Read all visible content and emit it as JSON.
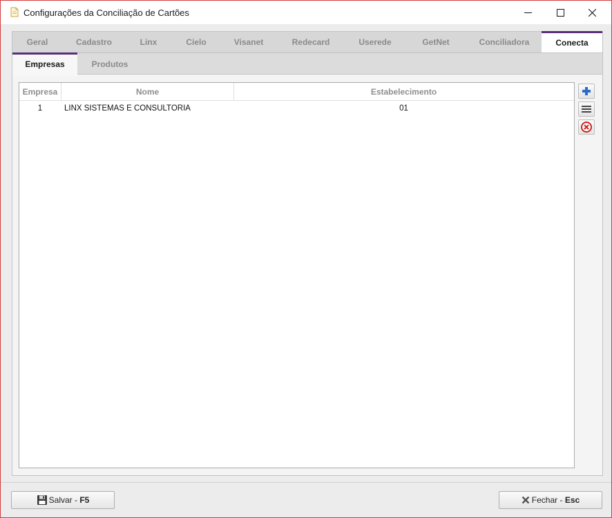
{
  "window": {
    "title": "Configurações da Conciliação de Cartões",
    "icon": "document-icon"
  },
  "main_tabs": [
    {
      "label": "Geral",
      "active": false
    },
    {
      "label": "Cadastro",
      "active": false
    },
    {
      "label": "Linx",
      "active": false
    },
    {
      "label": "Cielo",
      "active": false
    },
    {
      "label": "Visanet",
      "active": false
    },
    {
      "label": "Redecard",
      "active": false
    },
    {
      "label": "Userede",
      "active": false
    },
    {
      "label": "GetNet",
      "active": false
    },
    {
      "label": "Conciliadora",
      "active": false
    },
    {
      "label": "Conecta",
      "active": true
    }
  ],
  "sub_tabs": [
    {
      "label": "Empresas",
      "active": true
    },
    {
      "label": "Produtos",
      "active": false
    }
  ],
  "grid": {
    "columns": [
      "Empresa",
      "Nome",
      "Estabelecimento"
    ],
    "rows": [
      {
        "empresa": "1",
        "nome": "LINX SISTEMAS E CONSULTORIA",
        "estabelecimento": "01"
      }
    ]
  },
  "side_actions": [
    "add-icon",
    "list-icon",
    "delete-icon"
  ],
  "footer": {
    "save_label": "Salvar - ",
    "save_key": "F5",
    "close_label": "Fechar - ",
    "close_key": "Esc"
  },
  "colors": {
    "accent": "#5b2d7a",
    "window_border": "#d23a3a"
  }
}
